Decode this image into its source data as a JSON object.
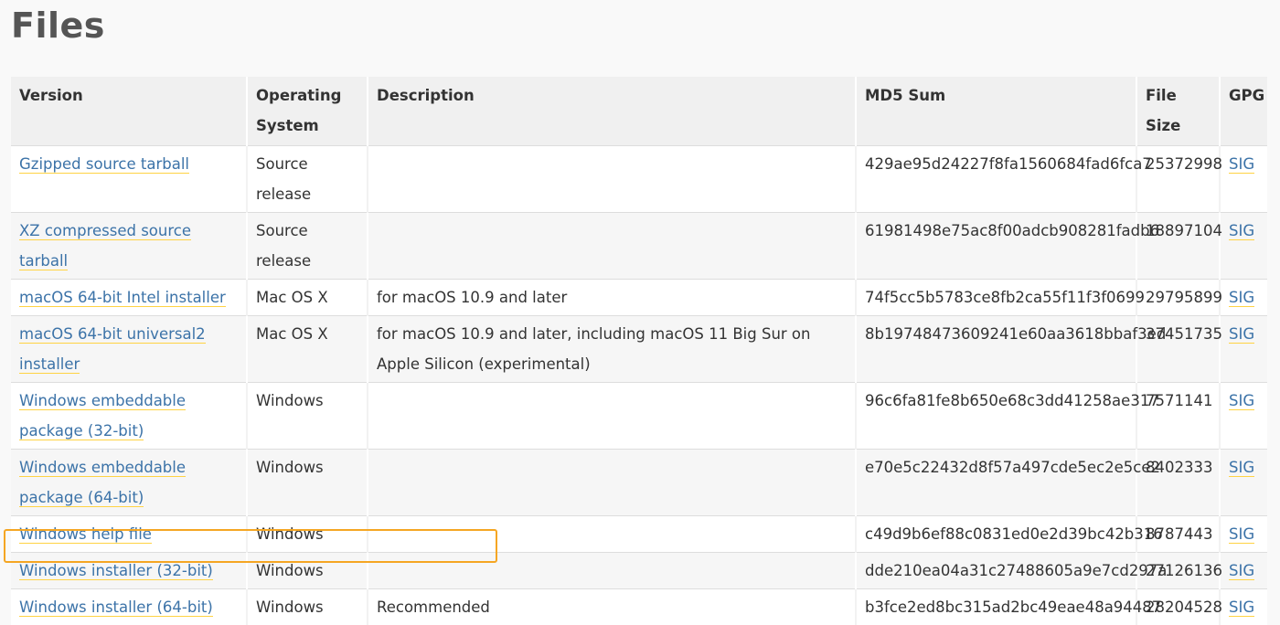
{
  "page": {
    "title": "Files"
  },
  "table": {
    "headers": {
      "version": "Version",
      "os": "Operating System",
      "description": "Description",
      "md5": "MD5 Sum",
      "size": "File Size",
      "gpg": "GPG"
    },
    "rows": [
      {
        "version": "Gzipped source tarball",
        "os": "Source release",
        "description": "",
        "md5": "429ae95d24227f8fa1560684fad6fca7",
        "size": "25372998",
        "gpg": "SIG"
      },
      {
        "version": "XZ compressed source tarball",
        "os": "Source release",
        "description": "",
        "md5": "61981498e75ac8f00adcb908281fadb6",
        "size": "18897104",
        "gpg": "SIG"
      },
      {
        "version": "macOS 64-bit Intel installer",
        "os": "Mac OS X",
        "description": "for macOS 10.9 and later",
        "md5": "74f5cc5b5783ce8fb2ca55f11f3f0699",
        "size": "29795899",
        "gpg": "SIG"
      },
      {
        "version": "macOS 64-bit universal2 installer",
        "os": "Mac OS X",
        "description": "for macOS 10.9 and later, including macOS 11 Big Sur on Apple Silicon (experimental)",
        "md5": "8b19748473609241e60aa3618bbaf3ed",
        "size": "37451735",
        "gpg": "SIG"
      },
      {
        "version": "Windows embeddable package (32-bit)",
        "os": "Windows",
        "description": "",
        "md5": "96c6fa81fe8b650e68c3dd41258ae317",
        "size": "7571141",
        "gpg": "SIG"
      },
      {
        "version": "Windows embeddable package (64-bit)",
        "os": "Windows",
        "description": "",
        "md5": "e70e5c22432d8f57a497cde5ec2e5ce2",
        "size": "8402333",
        "gpg": "SIG"
      },
      {
        "version": "Windows help file",
        "os": "Windows",
        "description": "",
        "md5": "c49d9b6ef88c0831ed0e2d39bc42b316",
        "size": "8787443",
        "gpg": "SIG"
      },
      {
        "version": "Windows installer (32-bit)",
        "os": "Windows",
        "description": "",
        "md5": "dde210ea04a31c27488605a9e7cd297a",
        "size": "27126136",
        "gpg": "SIG"
      },
      {
        "version": "Windows installer (64-bit)",
        "os": "Windows",
        "description": "Recommended",
        "md5": "b3fce2ed8bc315ad2bc49eae48a94487",
        "size": "28204528",
        "gpg": "SIG"
      }
    ]
  },
  "colors": {
    "link": "#3c73a8",
    "link_underline": "#ffd343",
    "highlight": "#f5a623",
    "header_bg": "#f0f0f0"
  }
}
